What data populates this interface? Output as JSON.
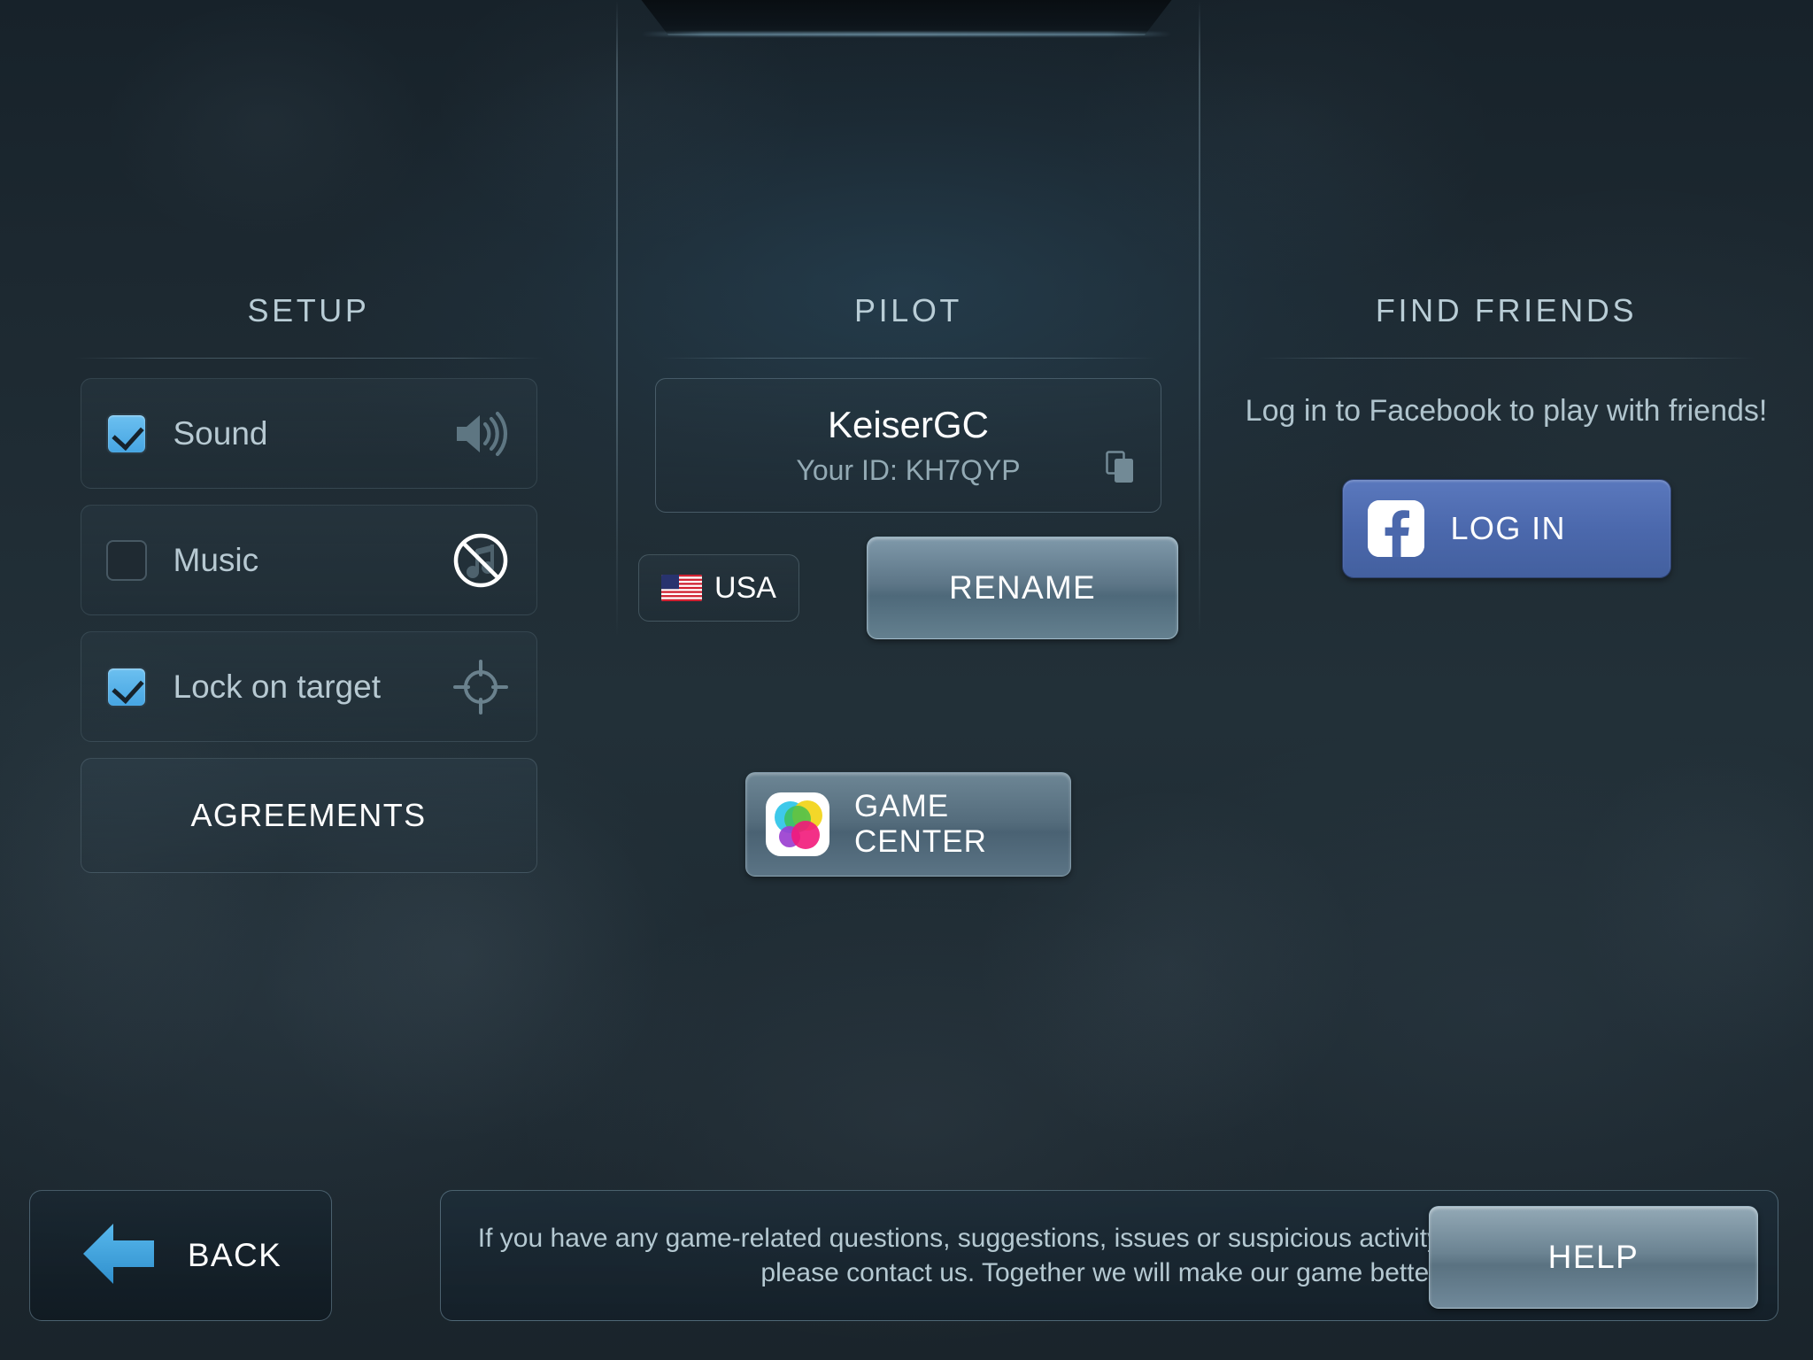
{
  "screen": {
    "background_color": "#1e2a32",
    "accent_color": "#4aa5e0"
  },
  "columns": {
    "setup": {
      "title": "SETUP",
      "settings": [
        {
          "label": "Sound",
          "checked": true,
          "icon": "speaker-on-icon"
        },
        {
          "label": "Music",
          "checked": false,
          "icon": "music-off-icon"
        },
        {
          "label": "Lock on target",
          "checked": true,
          "icon": "crosshair-icon"
        }
      ],
      "agreements_label": "AGREEMENTS"
    },
    "pilot": {
      "title": "PILOT",
      "name": "KeiserGC",
      "id_label": "Your ID: KH7QYP",
      "copy_icon": "copy-icon",
      "country_label": "USA",
      "country_flag": "usa-flag-icon",
      "rename_label": "RENAME",
      "game_center_label": "GAME CENTER",
      "game_center_icon": "game-center-icon"
    },
    "find_friends": {
      "title": "FIND FRIENDS",
      "prompt": "Log in to Facebook to play with friends!",
      "login_label": "LOG IN",
      "login_icon": "facebook-icon",
      "login_color": "#4b68ac"
    }
  },
  "bottom": {
    "back_label": "BACK",
    "back_icon": "arrow-left-icon",
    "help_text": "If you have any game-related questions, suggestions, issues or suspicious activity you would like to report, please contact us. Together we will make our game better!",
    "help_label": "HELP"
  }
}
